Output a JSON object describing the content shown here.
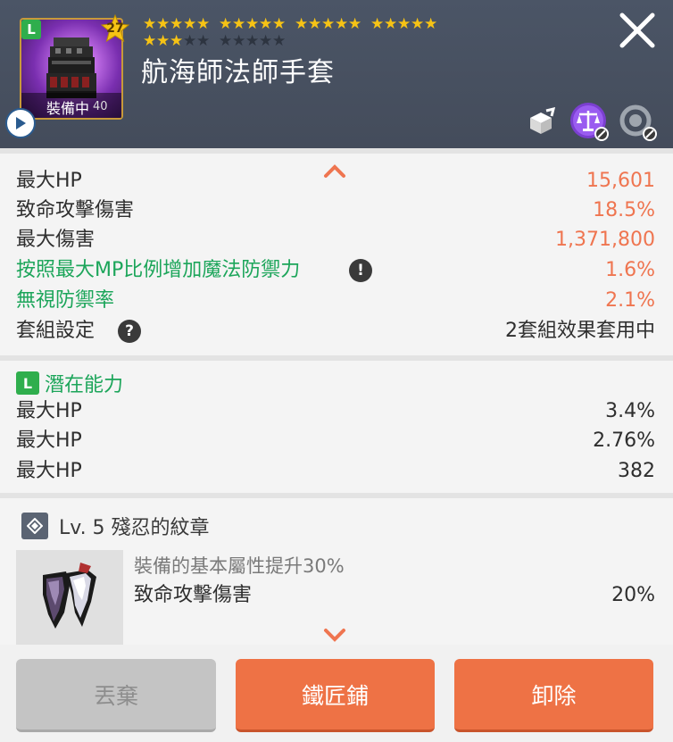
{
  "header": {
    "item_grade": "L",
    "star_level": "27",
    "equipped_label": "裝備中",
    "item_level": "40",
    "item_name": "航海師法師手套",
    "stars": {
      "total": 30,
      "filled": 23,
      "groups_per_row": 4,
      "stars_per_group": 5
    },
    "icons": [
      "play-icon",
      "close-icon",
      "share-icon",
      "compare-icon",
      "lock-icon"
    ]
  },
  "stats": {
    "rows": [
      {
        "label": "最大HP",
        "value": "15,601"
      },
      {
        "label": "致命攻擊傷害",
        "value": "18.5%"
      },
      {
        "label": "最大傷害",
        "value": "1,371,800"
      },
      {
        "label": "按照最大MP比例增加魔法防禦力",
        "value": "1.6%"
      },
      {
        "label": "無視防禦率",
        "value": "2.1%"
      },
      {
        "label": "套組設定",
        "value": "2套組效果套用中"
      }
    ],
    "info_glyph": "!",
    "help_glyph": "?"
  },
  "potential": {
    "grade": "L",
    "title": "潛在能力",
    "rows": [
      {
        "label": "最大HP",
        "value": "3.4%"
      },
      {
        "label": "最大HP",
        "value": "2.76%"
      },
      {
        "label": "最大HP",
        "value": "382"
      }
    ]
  },
  "emblem": {
    "title": "Lv. 5 殘忍的紋章",
    "description": "裝備的基本屬性提升30%",
    "stat_label": "致命攻擊傷害",
    "stat_value": "20%"
  },
  "buttons": {
    "discard": "丟棄",
    "blacksmith": "鐵匠鋪",
    "unequip": "卸除"
  },
  "colors": {
    "header_bg": "#4b5566",
    "accent_orange": "#ee7245",
    "stat_value_orange": "#ef7550",
    "green": "#1ca55a",
    "star_on": "#f6c315"
  }
}
